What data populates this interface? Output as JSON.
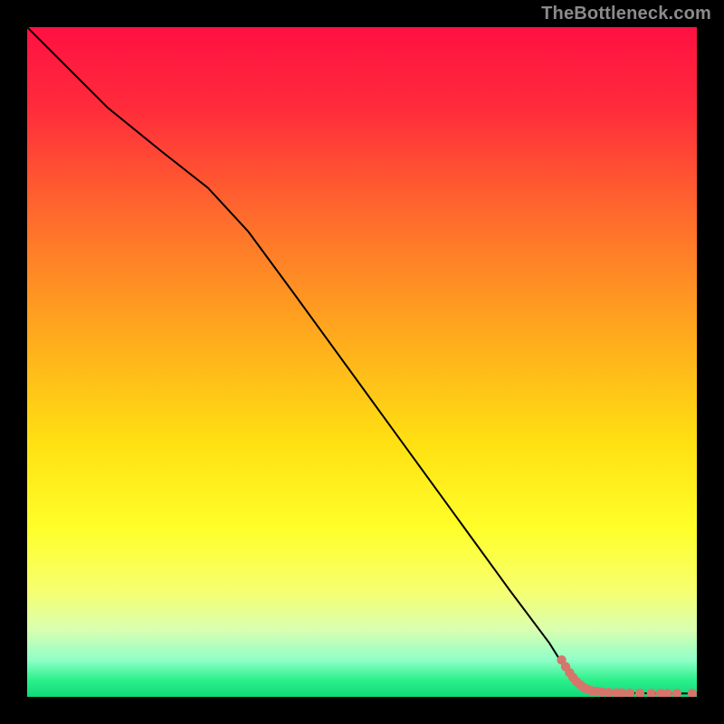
{
  "watermark": "TheBottleneck.com",
  "chart_data": {
    "type": "line",
    "title": "",
    "xlabel": "",
    "ylabel": "",
    "xlim": [
      0,
      100
    ],
    "ylim": [
      0,
      100
    ],
    "grid": false,
    "legend": false,
    "background": {
      "type": "vertical-gradient",
      "stops": [
        {
          "pos": 0,
          "color": "#ff1042"
        },
        {
          "pos": 12,
          "color": "#ff2b3b"
        },
        {
          "pos": 28,
          "color": "#ff6a2d"
        },
        {
          "pos": 45,
          "color": "#ffa61e"
        },
        {
          "pos": 62,
          "color": "#ffe012"
        },
        {
          "pos": 75,
          "color": "#ffff2a"
        },
        {
          "pos": 84,
          "color": "#f6ff6e"
        },
        {
          "pos": 90,
          "color": "#d9ffb0"
        },
        {
          "pos": 94.5,
          "color": "#8fffc8"
        },
        {
          "pos": 97.5,
          "color": "#2cf08b"
        },
        {
          "pos": 100,
          "color": "#10d878"
        }
      ]
    },
    "series": [
      {
        "name": "curve",
        "stroke": "#000000",
        "stroke_width": 2,
        "points": [
          {
            "x": 0.0,
            "y": 100.0
          },
          {
            "x": 5.0,
            "y": 95.0
          },
          {
            "x": 12.0,
            "y": 88.0
          },
          {
            "x": 20.0,
            "y": 81.5
          },
          {
            "x": 27.0,
            "y": 76.0
          },
          {
            "x": 33.0,
            "y": 69.5
          },
          {
            "x": 40.0,
            "y": 60.0
          },
          {
            "x": 48.0,
            "y": 49.0
          },
          {
            "x": 56.0,
            "y": 38.0
          },
          {
            "x": 64.0,
            "y": 27.0
          },
          {
            "x": 72.0,
            "y": 16.0
          },
          {
            "x": 78.0,
            "y": 8.0
          },
          {
            "x": 80.5,
            "y": 4.0
          },
          {
            "x": 82.0,
            "y": 2.4
          },
          {
            "x": 82.7,
            "y": 1.8
          },
          {
            "x": 83.4,
            "y": 1.3
          },
          {
            "x": 84.1,
            "y": 1.0
          },
          {
            "x": 85.2,
            "y": 0.8
          },
          {
            "x": 86.3,
            "y": 0.7
          },
          {
            "x": 88.0,
            "y": 0.6
          },
          {
            "x": 90.5,
            "y": 0.55
          },
          {
            "x": 93.0,
            "y": 0.52
          },
          {
            "x": 95.0,
            "y": 0.5
          },
          {
            "x": 97.5,
            "y": 0.5
          },
          {
            "x": 100.0,
            "y": 0.5
          }
        ]
      }
    ],
    "scatter": {
      "name": "dots",
      "color": "#d6756b",
      "radius_pct": 0.7,
      "points": [
        {
          "x": 79.8,
          "y": 5.5
        },
        {
          "x": 80.4,
          "y": 4.5
        },
        {
          "x": 81.0,
          "y": 3.6
        },
        {
          "x": 81.5,
          "y": 2.9
        },
        {
          "x": 82.0,
          "y": 2.3
        },
        {
          "x": 82.6,
          "y": 1.8
        },
        {
          "x": 83.1,
          "y": 1.4
        },
        {
          "x": 83.7,
          "y": 1.1
        },
        {
          "x": 84.3,
          "y": 0.9
        },
        {
          "x": 85.0,
          "y": 0.8
        },
        {
          "x": 85.8,
          "y": 0.7
        },
        {
          "x": 86.8,
          "y": 0.65
        },
        {
          "x": 88.0,
          "y": 0.6
        },
        {
          "x": 88.8,
          "y": 0.58
        },
        {
          "x": 90.0,
          "y": 0.55
        },
        {
          "x": 91.5,
          "y": 0.53
        },
        {
          "x": 93.2,
          "y": 0.52
        },
        {
          "x": 94.6,
          "y": 0.51
        },
        {
          "x": 95.6,
          "y": 0.5
        },
        {
          "x": 97.0,
          "y": 0.5
        },
        {
          "x": 99.3,
          "y": 0.5
        }
      ]
    }
  }
}
